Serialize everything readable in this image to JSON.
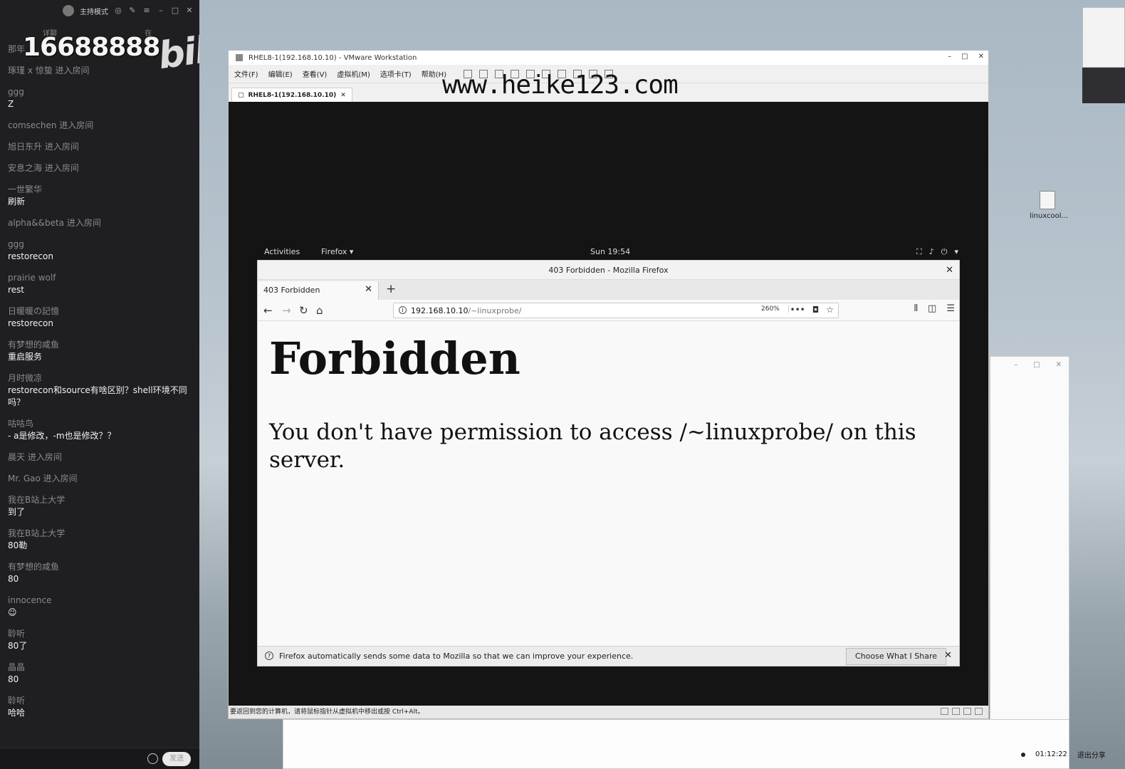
{
  "chat_panel": {
    "titlebar_mode": "主持模式",
    "subheader": [
      "详聊",
      "在线"
    ],
    "overlay_number": "16688888",
    "logo_text": "bilibili",
    "messages": [
      {
        "user": "那年",
        "text": "",
        "type": "enter"
      },
      {
        "user": "琢瑾 ⅹ 惊蛰 进入房间",
        "text": "",
        "type": "enter"
      },
      {
        "user": "ggg",
        "text": "Z",
        "type": "chat"
      },
      {
        "user": "comsechen 进入房间",
        "text": "",
        "type": "enter"
      },
      {
        "user": "旭日东升 进入房间",
        "text": "",
        "type": "enter"
      },
      {
        "user": "安息之海 进入房间",
        "text": "",
        "type": "enter"
      },
      {
        "user": "一世繁华",
        "text": "刷新",
        "type": "chat"
      },
      {
        "user": "alpha&&beta 进入房间",
        "text": "",
        "type": "enter"
      },
      {
        "user": "ggg",
        "text": "restorecon",
        "type": "chat"
      },
      {
        "user": "prairie wolf",
        "text": "rest",
        "type": "chat"
      },
      {
        "user": "日暖暖の記憶",
        "text": "restorecon",
        "type": "chat"
      },
      {
        "user": "有梦想的咸鱼",
        "text": "重启服务",
        "type": "chat"
      },
      {
        "user": "月时微凉",
        "text": "restorecon和source有啥区别？shell环境不同吗？",
        "type": "chat"
      },
      {
        "user": "咕咕鸟",
        "text": "- a是修改，-m也是修改？？",
        "type": "chat"
      },
      {
        "user": "晨天 进入房间",
        "text": "",
        "type": "enter"
      },
      {
        "user": "Mr. Gao 进入房间",
        "text": "",
        "type": "enter"
      },
      {
        "user": "我在B站上大学",
        "text": "到了",
        "type": "chat"
      },
      {
        "user": "我在B站上大学",
        "text": "80勒",
        "type": "chat"
      },
      {
        "user": "有梦想的咸鱼",
        "text": "80",
        "type": "chat"
      },
      {
        "user": "innocence",
        "text": "☺",
        "type": "chat"
      },
      {
        "user": "聆听",
        "text": "80了",
        "type": "chat"
      },
      {
        "user": "晶晶",
        "text": "80",
        "type": "chat"
      },
      {
        "user": "聆听",
        "text": "哈哈",
        "type": "chat"
      }
    ],
    "send_label": "发送"
  },
  "vmware": {
    "title": "RHEL8-1(192.168.10.10) - VMware Workstation",
    "window_controls": [
      "–",
      "□",
      "✕"
    ],
    "menus": [
      "文件(F)",
      "编辑(E)",
      "查看(V)",
      "虚拟机(M)",
      "选项卡(T)",
      "帮助(H)"
    ],
    "watermark": "www.heike123.com",
    "tab_label": "RHEL8-1(192.168.10.10)",
    "status_text": "要返回到您的计算机，请将鼠标指针从虚拟机中移出或按 Ctrl+Alt。"
  },
  "gnome": {
    "activities": "Activities",
    "app_menu": "Firefox ▾",
    "clock": "Sun 19:54",
    "system_icons": [
      "network-icon",
      "volume-icon",
      "power-icon"
    ]
  },
  "firefox": {
    "window_title": "403 Forbidden - Mozilla Firefox",
    "tab_title": "403 Forbidden",
    "url_host": "192.168.10.10",
    "url_path": "/~linuxprobe/",
    "zoom": "260%",
    "page": {
      "heading": "Forbidden",
      "message": "You don't have permission to access /~linuxprobe/ on this server."
    },
    "notification": {
      "text": "Firefox automatically sends some data to Mozilla so that we can improve your experience.",
      "button": "Choose What I Share"
    }
  },
  "desktop": {
    "file_label": "linuxcool...",
    "timer": "01:12:22",
    "exit_share": "退出分享"
  }
}
